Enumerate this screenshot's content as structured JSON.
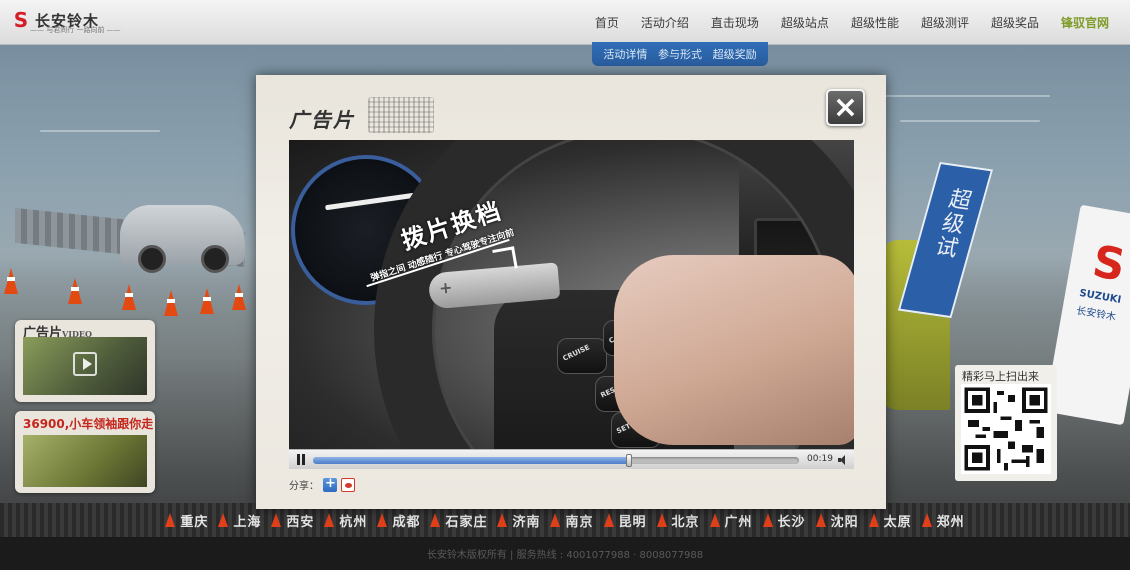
{
  "header": {
    "logo_text": "长安铃木",
    "logo_sub": "—— 与君同行   一路向前 ——",
    "nav": [
      {
        "label": "首页"
      },
      {
        "label": "活动介绍"
      },
      {
        "label": "直击现场"
      },
      {
        "label": "超级站点"
      },
      {
        "label": "超级性能"
      },
      {
        "label": "超级测评"
      },
      {
        "label": "超级奖品"
      },
      {
        "label": "锋驭官网"
      }
    ]
  },
  "subnav": [
    {
      "label": "活动详情"
    },
    {
      "label": "参与形式"
    },
    {
      "label": "超级奖励"
    }
  ],
  "sidebar": {
    "video_title": "广告片",
    "video_subtitle": "VIDEO",
    "promo_title": "36900,小车领袖跟你走"
  },
  "qr": {
    "title": "精彩马上扫出来"
  },
  "banner": {
    "text": "超级试",
    "suzuki": "SUZUKI",
    "suzuki_cn": "长安铃木"
  },
  "cities": [
    "重庆",
    "上海",
    "西安",
    "杭州",
    "成都",
    "石家庄",
    "济南",
    "南京",
    "昆明",
    "北京",
    "广州",
    "长沙",
    "沈阳",
    "太原",
    "郑州"
  ],
  "footer": {
    "text": "长安铃木版权所有  |  服务热线 : 4001077988 · 8008077988"
  },
  "modal": {
    "title": "广告片",
    "close_label": "×",
    "video": {
      "overlay_title": "拨片换档",
      "overlay_sub": "弹指之间 动感随行 专心驾驶专注向前",
      "controls": [
        "CRUISE",
        "CANCEL",
        "RES +",
        "SET −"
      ]
    },
    "player": {
      "time": "00:19",
      "progress": 0.65
    },
    "share_label": "分享："
  }
}
